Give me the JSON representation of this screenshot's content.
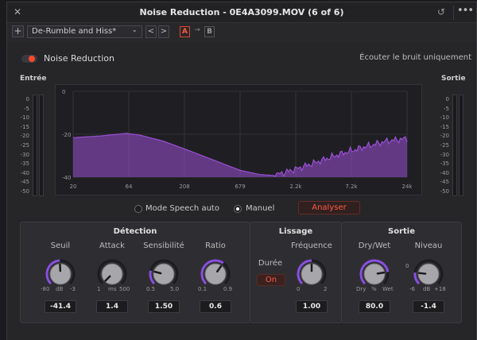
{
  "window": {
    "title": "Noise Reduction - 0E4A3099.MOV (6 of 6)"
  },
  "toolbar": {
    "add_label": "+",
    "preset": "De-Rumble and Hiss*",
    "chevron": "⌄",
    "prev": "<",
    "next": ">",
    "ab_a": "A",
    "ab_arrow": "→",
    "ab_b": "B"
  },
  "header": {
    "noise_reduction_label": "Noise Reduction",
    "noise_reduction_on": true,
    "listen_noise_only": "Écouter le bruit uniquement",
    "accent_color": "#ff4a2e"
  },
  "meters": {
    "input_label": "Entrée",
    "output_label": "Sortie",
    "scale": [
      "0",
      "-5",
      "-10",
      "-15",
      "-20",
      "-25",
      "-30",
      "-35",
      "-40",
      "-45",
      "-50"
    ]
  },
  "spectrum": {
    "y_ticks": [
      "0",
      "-20",
      "-40"
    ],
    "x_ticks": [
      "20",
      "64",
      "208",
      "679",
      "2.2k",
      "7.2k",
      "24k"
    ],
    "fill_color": "#9a4fd6"
  },
  "mode": {
    "auto_label": "Mode Speech auto",
    "manual_label": "Manuel",
    "auto_selected": false,
    "manual_selected": true,
    "analyze_label": "Analyser"
  },
  "detection": {
    "title": "Détection",
    "threshold": {
      "label": "Seuil",
      "min": "-80",
      "unit": "dB",
      "max": "-3",
      "value": "-41.4",
      "level": 0.49
    },
    "attack": {
      "label": "Attack",
      "min": "1",
      "unit": "ms",
      "max": "500",
      "value": "1.4",
      "level": 0.0
    },
    "sensitivity": {
      "label": "Sensibilité",
      "min": "0.5",
      "unit": "",
      "max": "5.0",
      "value": "1.50",
      "level": 0.22
    },
    "ratio": {
      "label": "Ratio",
      "min": "0.1",
      "unit": "",
      "max": "0.9",
      "value": "0.6",
      "level": 0.63
    }
  },
  "smoothing": {
    "title": "Lissage",
    "duration_label": "Durée",
    "duration_toggle": "On",
    "frequency": {
      "label": "Fréquence",
      "min": "0",
      "unit": "",
      "max": "2",
      "value": "1.00",
      "level": 0.5
    }
  },
  "output": {
    "title": "Sortie",
    "drywet": {
      "label": "Dry/Wet",
      "min": "Dry",
      "unit": "%",
      "max": "Wet",
      "value": "80.0",
      "level": 0.8
    },
    "level": {
      "label": "Niveau",
      "zero": "0",
      "min": "-6",
      "unit": "dB",
      "max": "+18",
      "value": "-1.4",
      "level": 0.19
    }
  }
}
